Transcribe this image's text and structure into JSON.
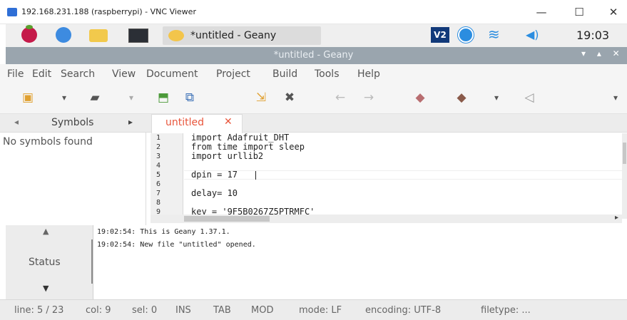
{
  "vnc": {
    "title": "192.168.231.188 (raspberrypi) - VNC Viewer",
    "minimize": "—",
    "maximize": "☐",
    "close": "✕"
  },
  "panel": {
    "task_label": "*untitled - Geany",
    "vnc_badge": "V2",
    "clock": "19:03"
  },
  "geany": {
    "title": "*untitled - Geany",
    "title_controls": "▾ ▴ ✕",
    "menu": [
      "File",
      "Edit",
      "Search",
      "View",
      "Document",
      "Project",
      "Build",
      "Tools",
      "Help"
    ],
    "toolbar_icons": [
      "new-file-icon",
      "dropdown-arrow-icon",
      "open-file-icon",
      "dropdown-arrow-icon",
      "save-icon",
      "save-all-icon",
      "revert-icon",
      "close-file-icon",
      "back-arrow-icon",
      "forward-arrow-icon",
      "compile-icon",
      "build-icon",
      "dropdown-arrow-icon",
      "execute-icon",
      "toolbar-overflow-icon"
    ],
    "toolbar_glyphs": [
      "▣",
      "▾",
      "▰",
      "▾",
      "⬒",
      "⧉",
      "⇲",
      "✖",
      "←",
      "→",
      "◆",
      "◆",
      "▾",
      "◁",
      "▾"
    ],
    "sidebar": {
      "tab_prev": "◂",
      "tab_label": "Symbols",
      "tab_next": "▸",
      "empty_text": "No symbols found"
    },
    "document_tab": {
      "label": "untitled",
      "close": "✕"
    },
    "line_numbers": [
      "1",
      "2",
      "3",
      "4",
      "5",
      "6",
      "7",
      "8",
      "9"
    ],
    "code_lines": [
      "import Adafruit_DHT",
      "from time import sleep",
      "import urllib2",
      "",
      "dpin = 17",
      "",
      "delay= 10",
      "",
      "key = '9F5B0267Z5PTRMFC'"
    ],
    "messages_panel": {
      "up_arrow": "▲",
      "tab_label": "Status",
      "down_arrow": "▼",
      "lines": [
        "19:02:54: This is Geany 1.37.1.",
        "19:02:54: New file \"untitled\" opened."
      ]
    },
    "statusbar": {
      "line": "line: 5 / 23",
      "col": "col: 9",
      "sel": "sel: 0",
      "ins": "INS",
      "tab": "TAB",
      "mod": "MOD",
      "mode": "mode: LF",
      "encoding": "encoding: UTF-8",
      "filetype": "filetype: ..."
    }
  }
}
